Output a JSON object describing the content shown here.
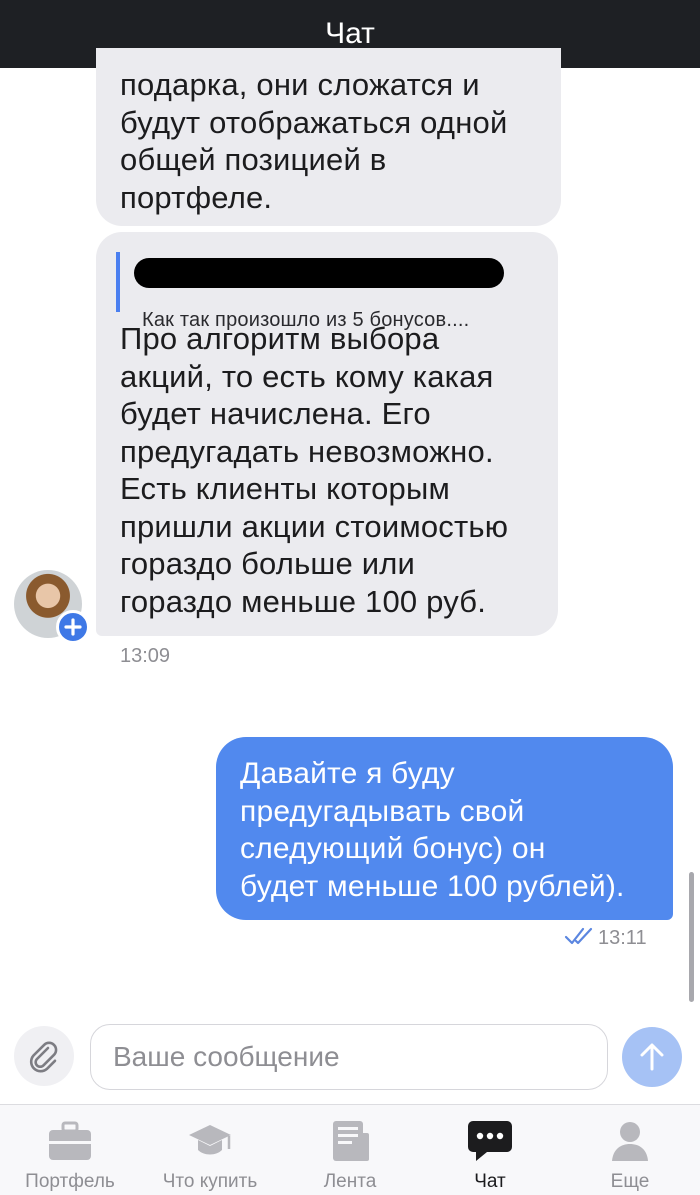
{
  "header": {
    "title": "Чат"
  },
  "messages": {
    "incoming_1": {
      "text": "подарка, они сложатся и\nбудут отображаться одной\nобщей позицией в\nпортфеле."
    },
    "incoming_2": {
      "quote_text": "Как так произошло из 5 бонусов....",
      "text": "Про алгоритм выбора\nакций, то есть кому какая\nбудет начислена. Его\nпредугадать невозможно.\nЕсть клиенты которым\nпришли акции стоимостью\nгораздо больше или\nгораздо меньше 100 руб.",
      "time": "13:09"
    },
    "outgoing_1": {
      "text": "Давайте я буду\nпредугадывать свой\nследующий бонус) он\nбудет меньше 100 рублей).",
      "time": "13:11",
      "status": "read"
    }
  },
  "composer": {
    "placeholder": "Ваше сообщение"
  },
  "tabs": [
    {
      "label": "Портфель",
      "icon": "briefcase-icon",
      "active": false
    },
    {
      "label": "Что купить",
      "icon": "graduation-cap-icon",
      "active": false
    },
    {
      "label": "Лента",
      "icon": "newspaper-icon",
      "active": false
    },
    {
      "label": "Чат",
      "icon": "chat-bubble-icon",
      "active": true
    },
    {
      "label": "Еще",
      "icon": "person-icon",
      "active": false
    }
  ],
  "colors": {
    "header_bg": "#1e2024",
    "incoming_bubble": "#ebebef",
    "outgoing_bubble": "#5189ee",
    "accent": "#3e78e6",
    "send_button": "#a6c2f5"
  }
}
